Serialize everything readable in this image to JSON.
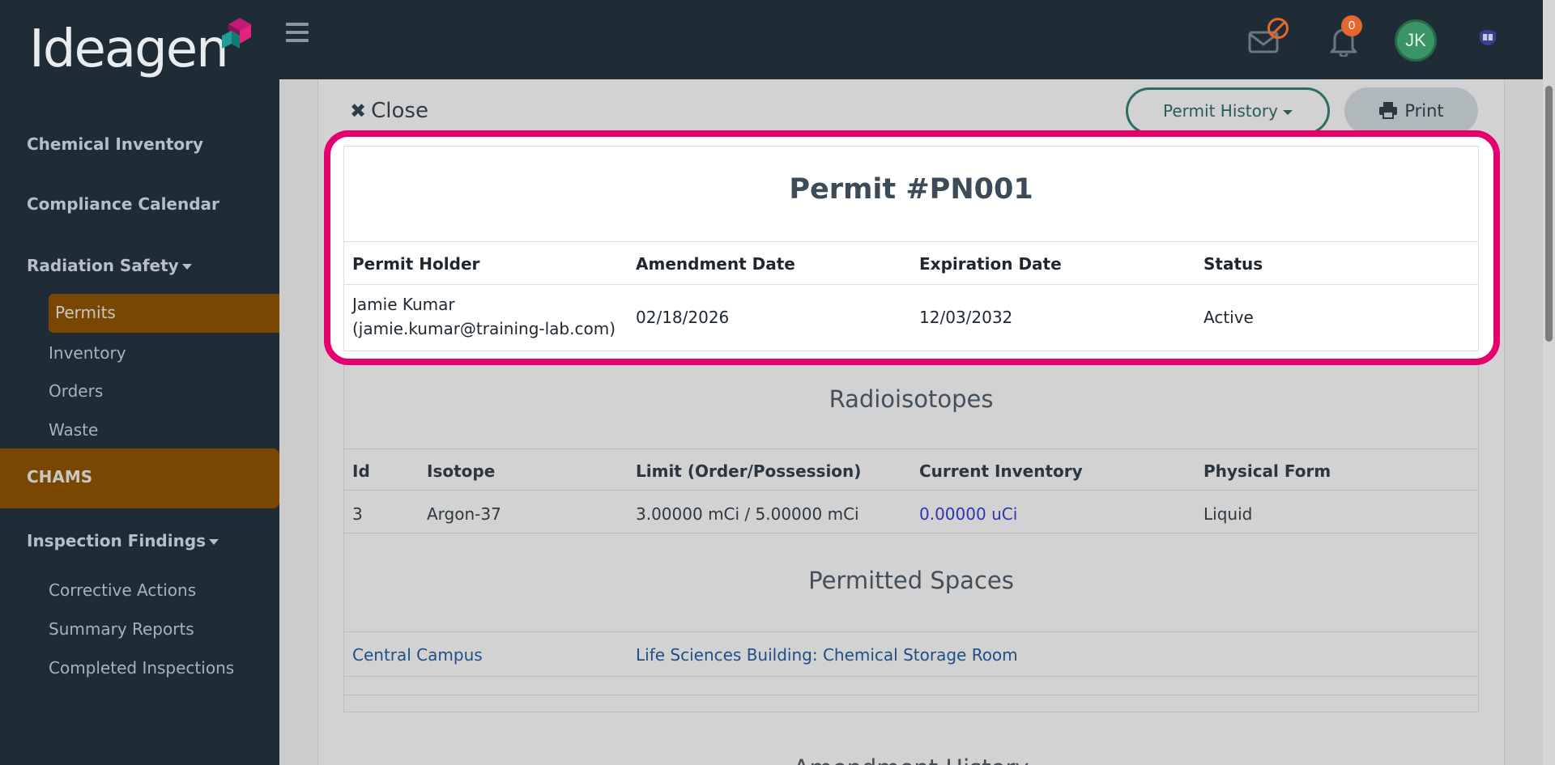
{
  "app": {
    "logo_text": "Ideagen"
  },
  "header": {
    "notifications_count": "0",
    "avatar_initials": "JK"
  },
  "sidebar": {
    "chemical_inventory": "Chemical Inventory",
    "compliance_calendar": "Compliance Calendar",
    "radiation_safety": "Radiation Safety",
    "permits": "Permits",
    "inventory": "Inventory",
    "orders": "Orders",
    "waste": "Waste",
    "chams": "CHAMS",
    "inspection_findings": "Inspection Findings",
    "corrective_actions": "Corrective Actions",
    "summary_reports": "Summary Reports",
    "completed_inspections": "Completed Inspections"
  },
  "toolbar": {
    "close_label": "Close",
    "permit_history_label": "Permit History",
    "print_label": "Print"
  },
  "permit": {
    "title": "Permit #PN001",
    "headers": {
      "holder": "Permit Holder",
      "amendment": "Amendment Date",
      "expiration": "Expiration Date",
      "status": "Status"
    },
    "holder_name": "Jamie Kumar",
    "holder_email": "(jamie.kumar@training-lab.com)",
    "amendment_date": "02/18/2026",
    "expiration_date": "12/03/2032",
    "status": "Active"
  },
  "radioisotopes": {
    "title": "Radioisotopes",
    "headers": {
      "id": "Id",
      "isotope": "Isotope",
      "limit": "Limit (Order/Possession)",
      "current": "Current Inventory",
      "form": "Physical Form"
    },
    "row": {
      "id": "3",
      "isotope": "Argon-37",
      "limit": "3.00000 mCi / 5.00000 mCi",
      "current": "0.00000 uCi",
      "form": "Liquid"
    }
  },
  "spaces": {
    "title": "Permitted Spaces",
    "campus": "Central Campus",
    "location": "Life Sciences Building: Chemical Storage Room"
  },
  "amendment_history": {
    "title": "Amendment History"
  }
}
